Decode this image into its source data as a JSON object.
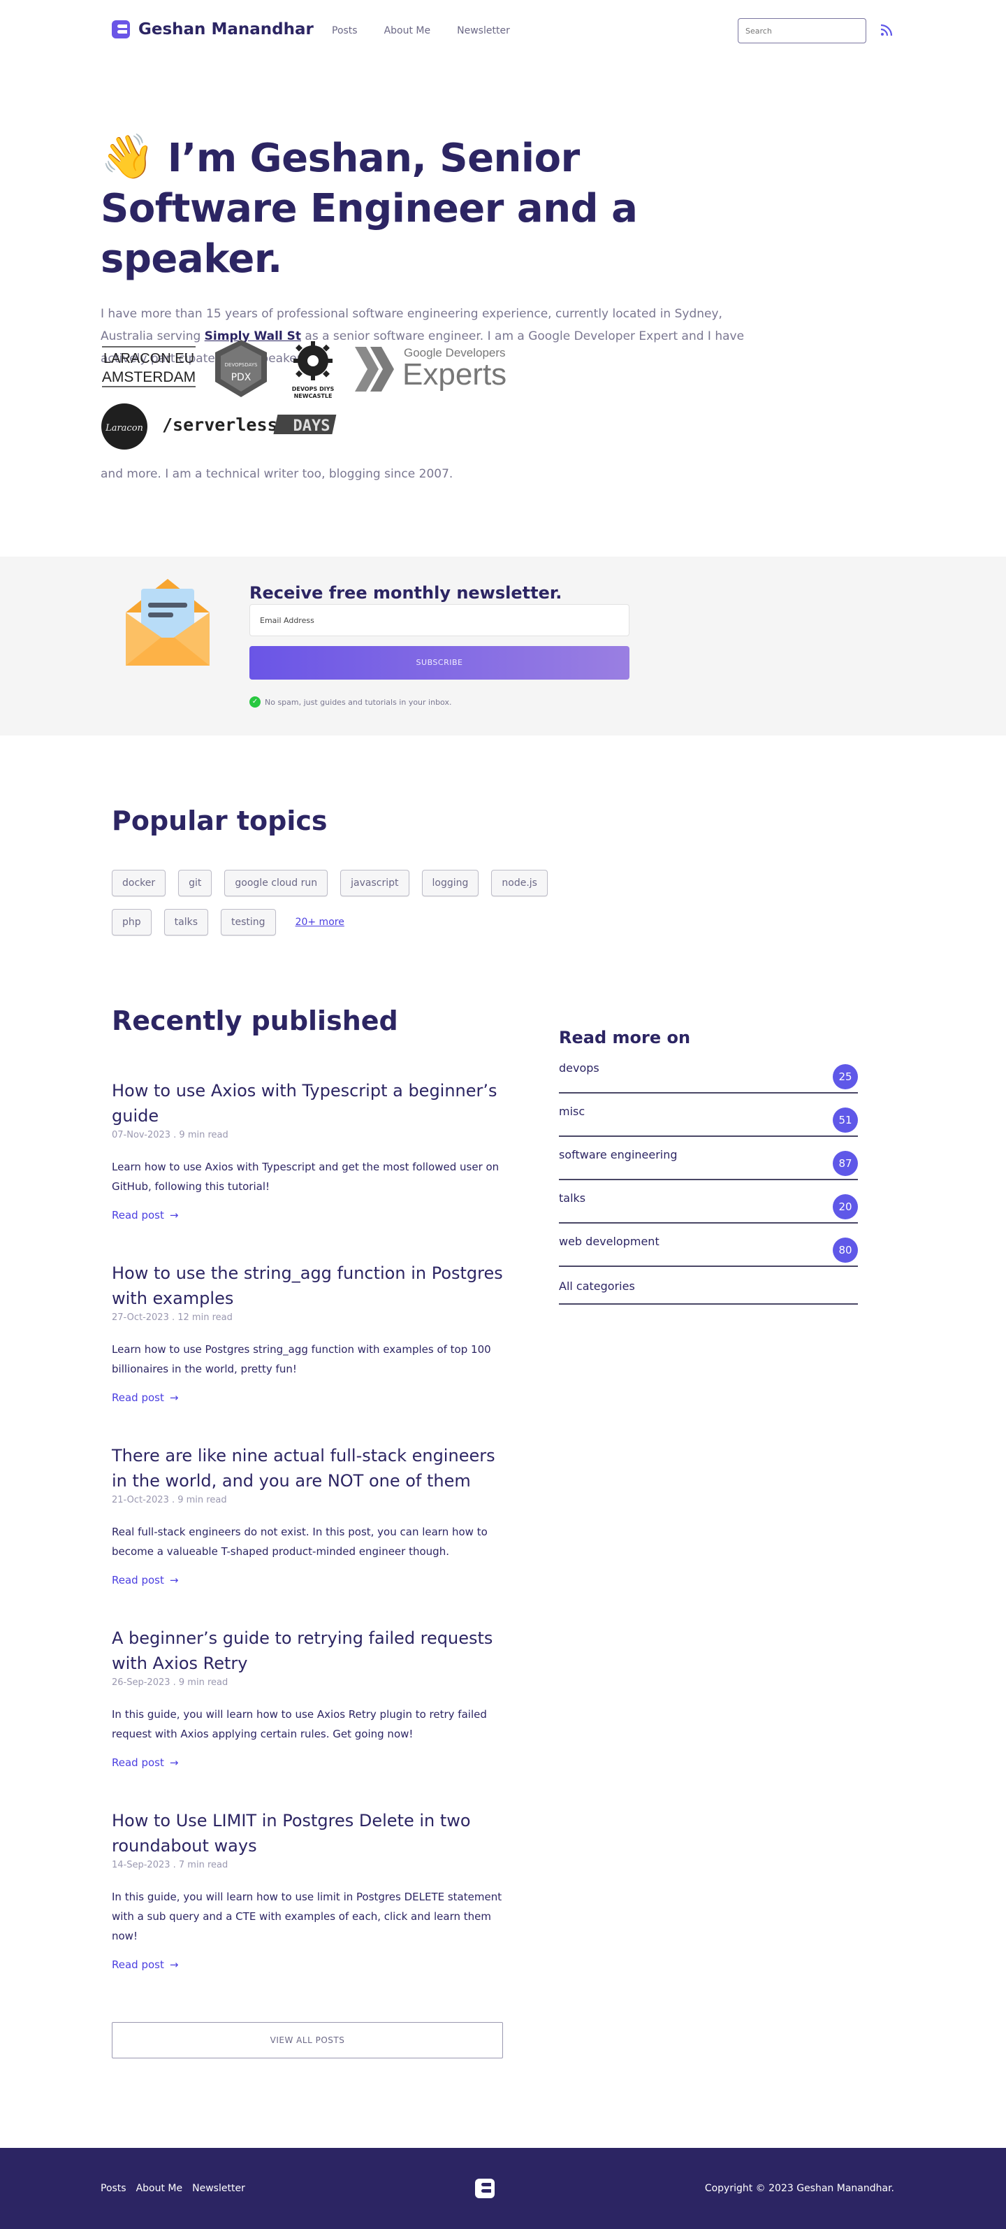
{
  "header": {
    "brand": "Geshan Manandhar",
    "nav": [
      "Posts",
      "About Me",
      "Newsletter"
    ],
    "search_placeholder": "Search"
  },
  "hero": {
    "wave": "👋",
    "title": "I’m Geshan, Senior Software Engineer and a speaker.",
    "intro_1": "I have more than 15 years of professional software engineering experience, currently located in Sydney, Australia serving ",
    "company": "Simply Wall St",
    "intro_2": " as a senior software engineer. I am a Google Developer Expert and I have actively participated as a speaker in:",
    "logos": {
      "laracon_eu_1": "LARACON EU",
      "laracon_eu_2": "AMSTERDAM",
      "devopsdays_pdx_1": "DEVOPSDAYS",
      "devopsdays_pdx_2": "PDX",
      "devops_newcastle_1": "DEVOPS DIYS",
      "devops_newcastle_2": "NEWCASTLE",
      "gde_1": "Google Developers",
      "gde_2": "Experts",
      "laracon": "Laracon",
      "serverless_1": "/serverless/",
      "serverless_2": "DAYS"
    },
    "outro": "and more. I am a technical writer too, blogging since 2007."
  },
  "newsletter": {
    "title": "Receive free monthly newsletter.",
    "email_placeholder": "Email Address",
    "button": "SUBSCRIBE",
    "note": "No spam, just guides and tutorials in your inbox."
  },
  "topics": {
    "title": "Popular topics",
    "tags_row1": [
      "docker",
      "git",
      "google cloud run",
      "javascript",
      "logging",
      "node.js"
    ],
    "tags_row2": [
      "php",
      "talks",
      "testing"
    ],
    "more": "20+ more"
  },
  "recent": {
    "title": "Recently published",
    "read_label": "Read post",
    "view_all": "VIEW ALL POSTS",
    "posts": [
      {
        "title": "How to use Axios with Typescript a beginner’s guide",
        "meta": "07-Nov-2023 . 9 min read",
        "desc": "Learn how to use Axios with Typescript and get the most followed user on GitHub, following this tutorial!"
      },
      {
        "title": "How to use the string_agg function in Postgres with examples",
        "meta": "27-Oct-2023 . 12 min read",
        "desc": "Learn how to use Postgres string_agg function with examples of top 100 billionaires in the world, pretty fun!"
      },
      {
        "title": "There are like nine actual full-stack engineers in the world, and you are NOT one of them",
        "meta": "21-Oct-2023 . 9 min read",
        "desc": "Real full-stack engineers do not exist. In this post, you can learn how to become a valueable T-shaped product-minded engineer though."
      },
      {
        "title": "A beginner’s guide to retrying failed requests with Axios Retry",
        "meta": "26-Sep-2023 . 9 min read",
        "desc": "In this guide, you will learn how to use Axios Retry plugin to retry failed request with Axios applying certain rules. Get going now!"
      },
      {
        "title": "How to Use LIMIT in Postgres Delete in two roundabout ways",
        "meta": "14-Sep-2023 . 7 min read",
        "desc": "In this guide, you will learn how to use limit in Postgres DELETE statement with a sub query and a CTE with examples of each, click and learn them now!"
      }
    ]
  },
  "sidebar": {
    "title": "Read more on",
    "categories": [
      {
        "name": "devops",
        "count": "25"
      },
      {
        "name": "misc",
        "count": "51"
      },
      {
        "name": "software engineering",
        "count": "87"
      },
      {
        "name": "talks",
        "count": "20"
      },
      {
        "name": "web development",
        "count": "80"
      }
    ],
    "all": "All categories"
  },
  "footer": {
    "nav": [
      "Posts",
      "About Me",
      "Newsletter"
    ],
    "copyright": "Copyright © 2023 Geshan Manandhar."
  },
  "colors": {
    "brand": "#2c2563",
    "accent": "#6a55e6",
    "link": "#4b3fe0",
    "badge": "#5f58e8"
  }
}
